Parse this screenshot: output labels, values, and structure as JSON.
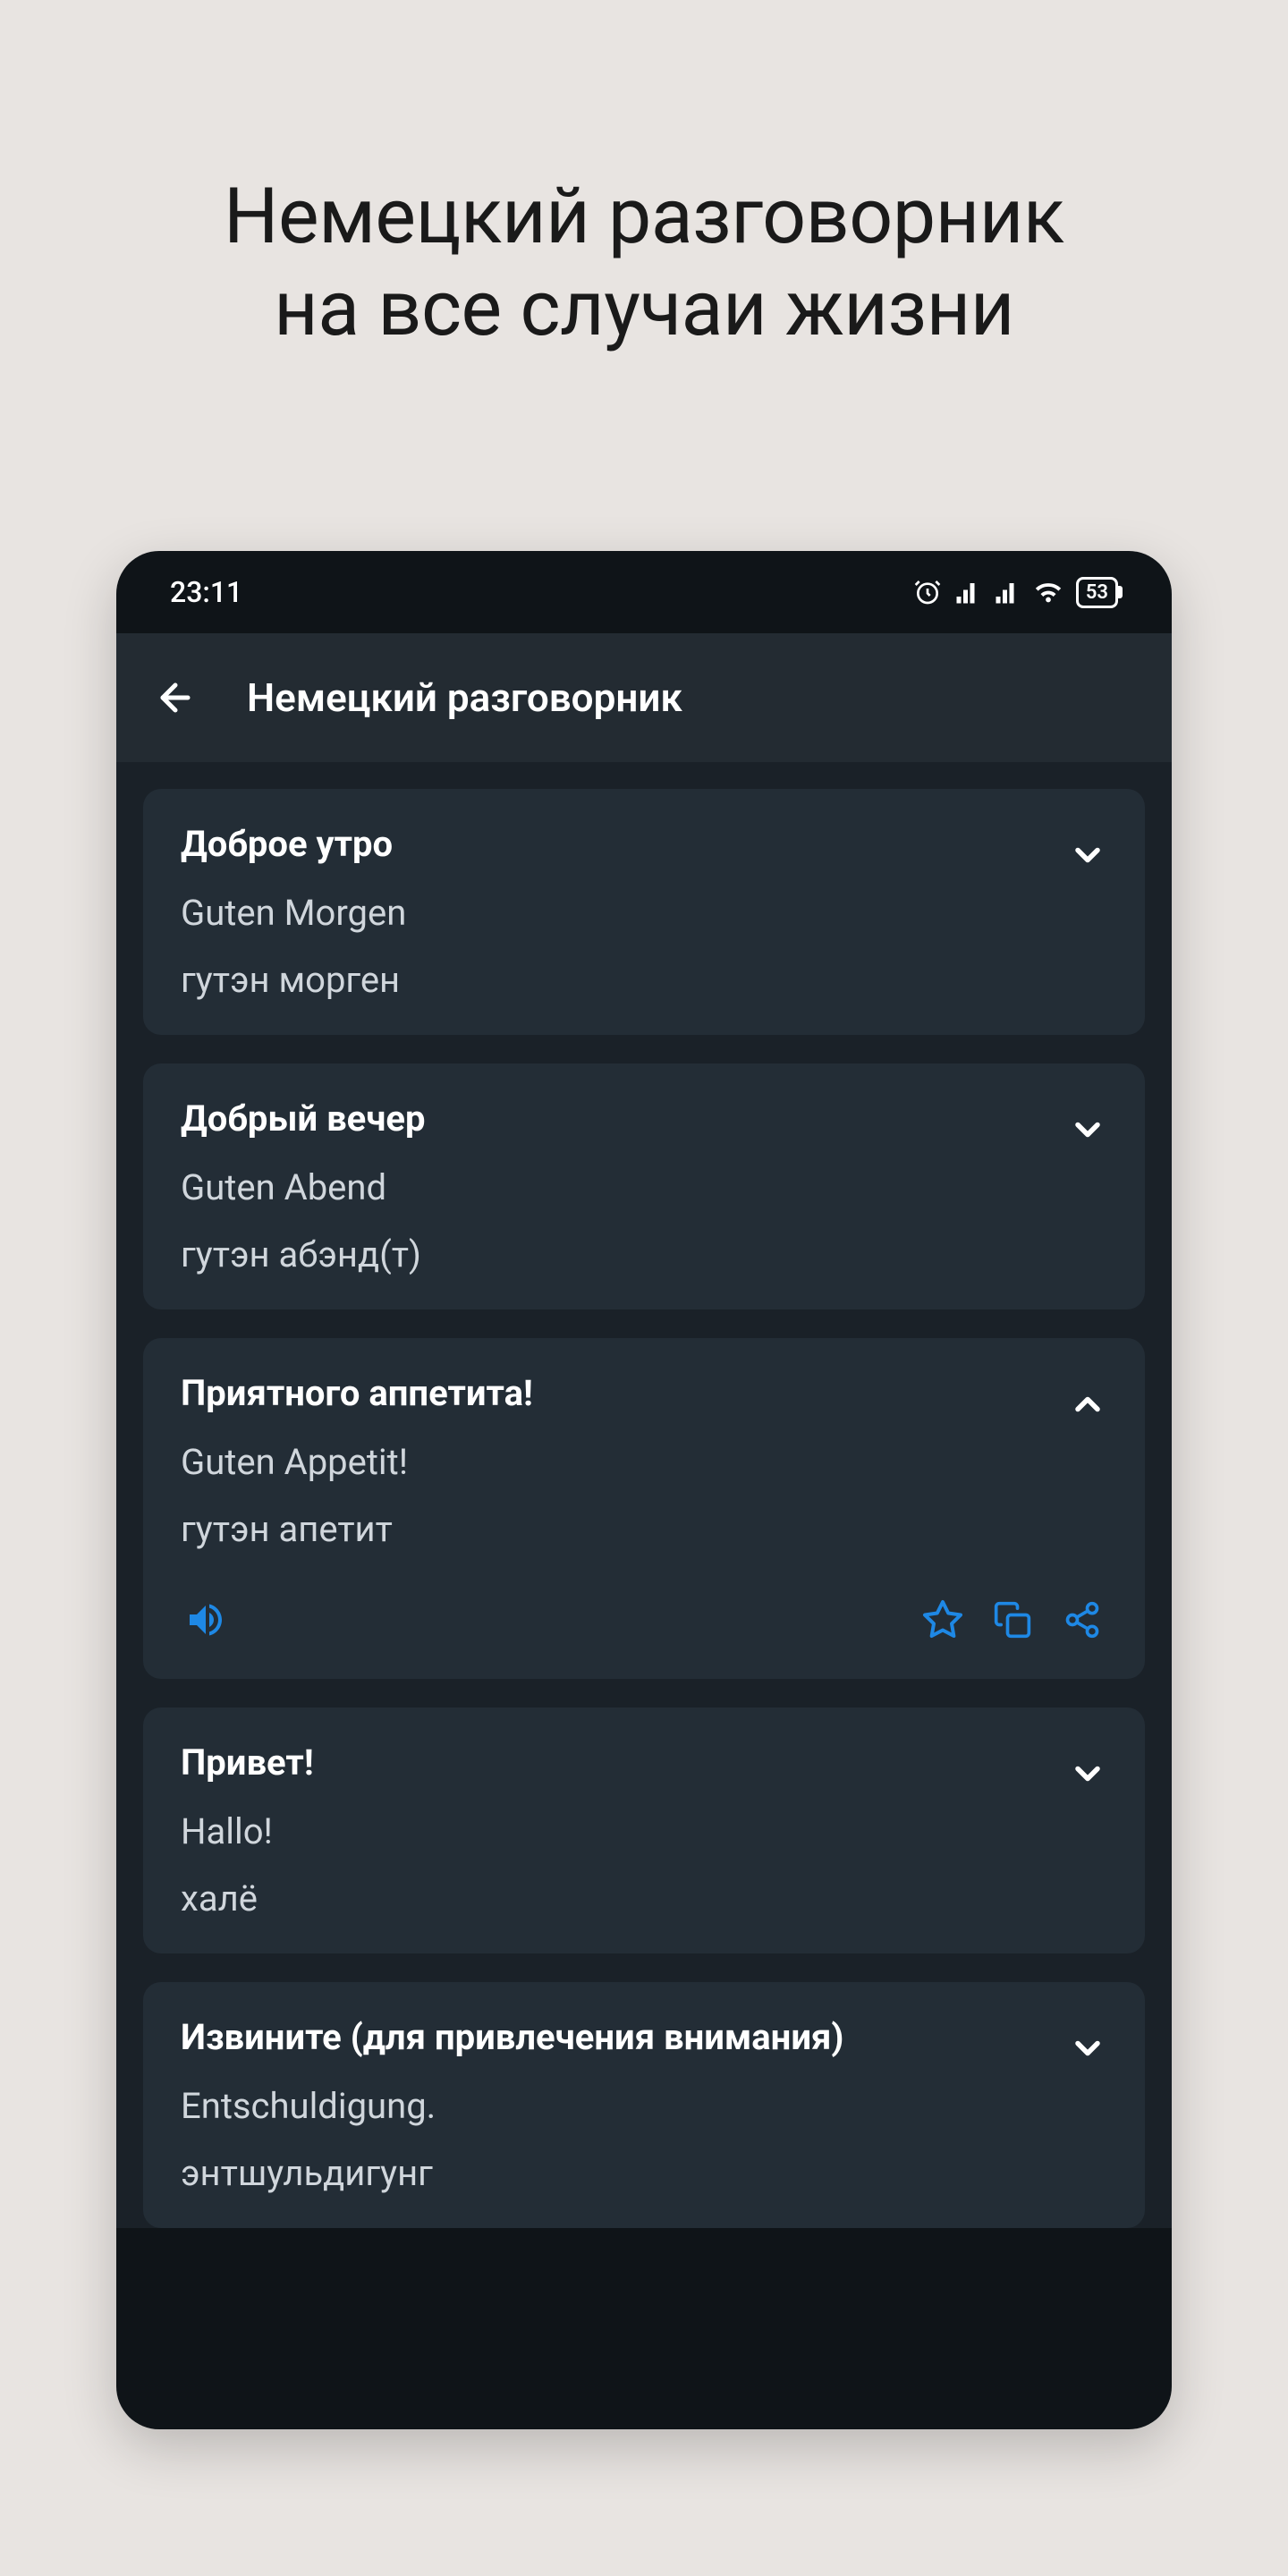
{
  "hero": {
    "line1": "Немецкий разговорник",
    "line2": "на все случаи жизни"
  },
  "status": {
    "time": "23:11",
    "battery": "53"
  },
  "header": {
    "title": "Немецкий разговорник"
  },
  "cards": [
    {
      "title": "Доброе утро",
      "translation": "Guten Morgen",
      "transcription": "гутэн морген",
      "expanded": false
    },
    {
      "title": "Добрый вечер",
      "translation": "Guten Abend",
      "transcription": "гутэн абэнд(т)",
      "expanded": false
    },
    {
      "title": "Приятного аппетита!",
      "translation": "Guten Appetit!",
      "transcription": "гутэн апетит",
      "expanded": true
    },
    {
      "title": "Привет!",
      "translation": "Hallo!",
      "transcription": "халё",
      "expanded": false
    },
    {
      "title": "Извините (для привлечения внимания)",
      "translation": "Entschuldigung.",
      "transcription": "энтшульдигунг",
      "expanded": false
    }
  ],
  "colors": {
    "accent": "#1e88e5"
  }
}
